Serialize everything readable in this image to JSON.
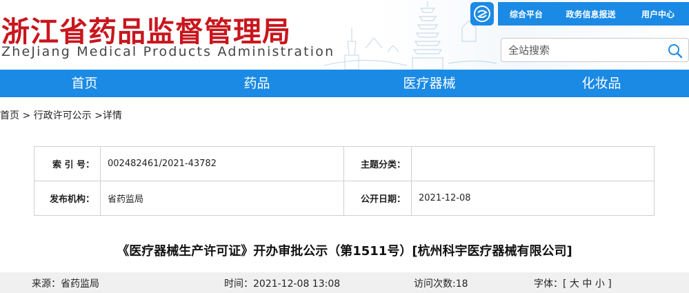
{
  "header": {
    "title": "浙江省药品监督管理局",
    "subtitle": "ZheJiang Medical Products Administration",
    "logo_icon": "zhe-logo-icon",
    "top_links": [
      "综合平台",
      "政务信息报送",
      "用户中心"
    ],
    "search": {
      "placeholder": "全站搜索",
      "icon": "search-icon"
    }
  },
  "nav": {
    "items": [
      "首页",
      "药品",
      "医疗器械",
      "化妆品"
    ]
  },
  "breadcrumb": {
    "home": "首页",
    "sep": " > ",
    "section": "行政许可公示",
    "sep2": " >",
    "current": "详情"
  },
  "meta": {
    "index_label": "索 引 号：",
    "index_value": "002482461/2021-43782",
    "category_label": "主题分类：",
    "category_value": "",
    "publisher_label": "发布机构：",
    "publisher_value": "省药监局",
    "date_label": "公开日期：",
    "date_value": "2021-12-08"
  },
  "article": {
    "title": "《医疗器械生产许可证》开办审批公示（第1511号）[杭州科宇医疗器械有限公司]"
  },
  "info": {
    "source": "来源：省药监局",
    "time": "时间：2021-12-08 13:08",
    "views": "访问次数:18",
    "font_label": "字体：[",
    "font_large": "大",
    "font_medium": "中",
    "font_small": "小",
    "font_close": "]"
  },
  "colors": {
    "brand_red": "#c8161d",
    "nav_blue": "#1a8ae5"
  }
}
